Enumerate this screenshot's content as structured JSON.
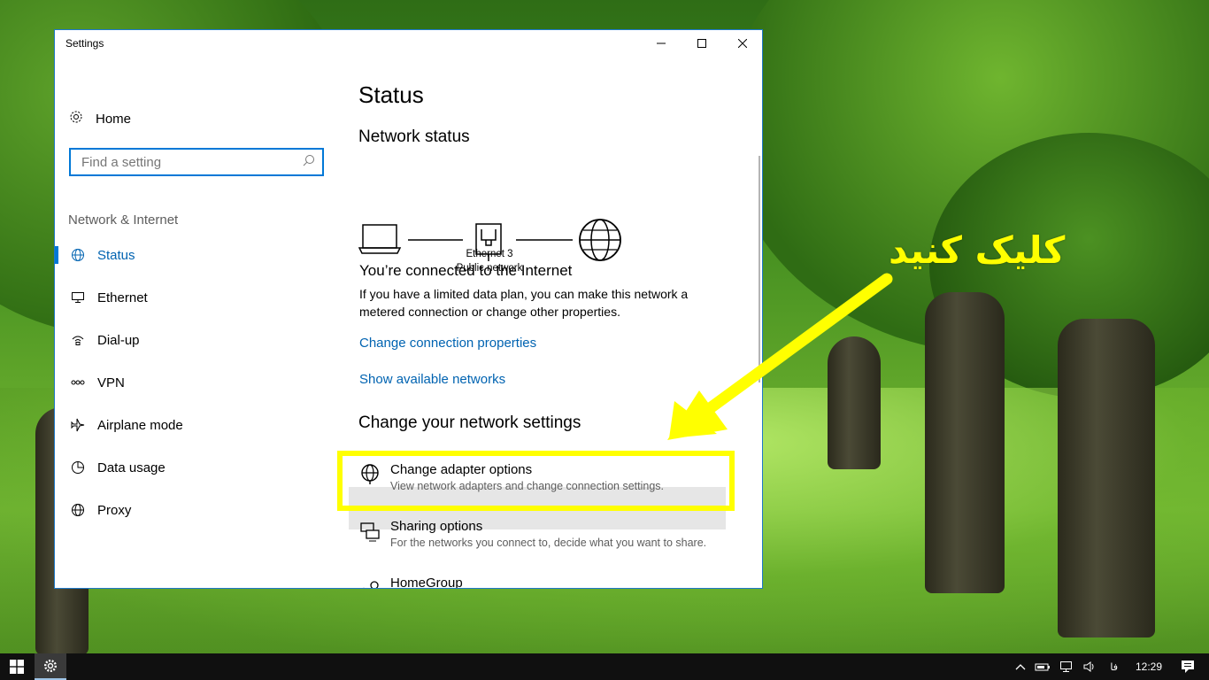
{
  "window": {
    "title": "Settings",
    "controls": {
      "minimize": "minimize",
      "maximize": "maximize",
      "close": "close"
    }
  },
  "sidebar": {
    "home_label": "Home",
    "search_placeholder": "Find a setting",
    "section_title": "Network & Internet",
    "items": [
      {
        "label": "Status",
        "icon": "globe-icon",
        "active": true
      },
      {
        "label": "Ethernet",
        "icon": "ethernet-icon"
      },
      {
        "label": "Dial-up",
        "icon": "dialup-icon"
      },
      {
        "label": "VPN",
        "icon": "vpn-icon"
      },
      {
        "label": "Airplane mode",
        "icon": "airplane-icon"
      },
      {
        "label": "Data usage",
        "icon": "data-usage-icon"
      },
      {
        "label": "Proxy",
        "icon": "globe-icon"
      }
    ]
  },
  "main": {
    "title": "Status",
    "network_status_heading": "Network status",
    "diagram": {
      "adapter_name": "Ethernet 3",
      "network_type": "Public network"
    },
    "connected_heading": "You’re connected to the Internet",
    "connected_desc": "If you have a limited data plan, you can make this network a metered connection or change other properties.",
    "link_change_connection": "Change connection properties",
    "link_show_networks": "Show available networks",
    "change_settings_heading": "Change your network settings",
    "options": [
      {
        "title": "Change adapter options",
        "desc": "View network adapters and change connection settings.",
        "icon": "adapter-icon"
      },
      {
        "title": "Sharing options",
        "desc": "For the networks you connect to, decide what you want to share.",
        "icon": "sharing-icon"
      },
      {
        "title": "HomeGroup",
        "desc": "",
        "icon": "homegroup-icon"
      }
    ]
  },
  "annotation": {
    "text": "کلیک کنید",
    "color": "#ffff00"
  },
  "taskbar": {
    "language": "فا",
    "time": "12:29"
  },
  "colors": {
    "accent": "#0078d7",
    "link": "#0063b1",
    "highlight": "#ffff00"
  }
}
